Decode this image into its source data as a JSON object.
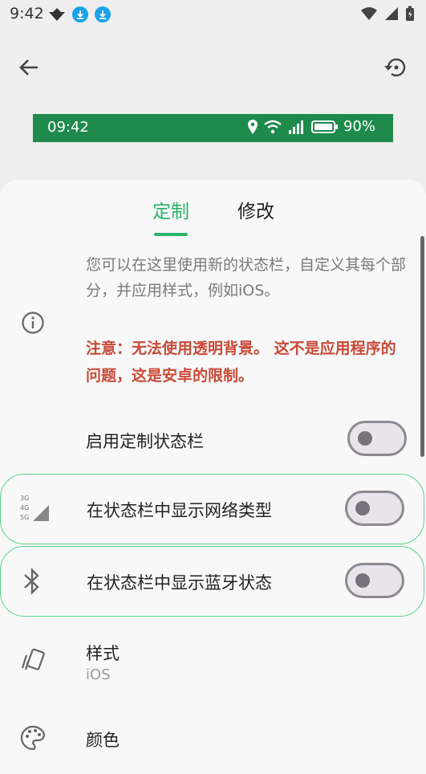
{
  "status_bar": {
    "time": "9:42"
  },
  "preview": {
    "time": "09:42",
    "battery": "90%"
  },
  "tabs": [
    {
      "label": "定制"
    },
    {
      "label": "修改"
    }
  ],
  "info": {
    "text": "您可以在这里使用新的状态栏，自定义其每个部分，并应用样式，例如iOS。",
    "warning": "注意：无法使用透明背景。 这不是应用程序的问题，这是安卓的限制。"
  },
  "settings": [
    {
      "label": "启用定制状态栏",
      "enabled": false
    },
    {
      "label": "在状态栏中显示网络类型",
      "enabled": false
    },
    {
      "label": "在状态栏中显示蓝牙状态",
      "enabled": false
    }
  ],
  "style": {
    "label": "样式",
    "value": "iOS"
  },
  "color": {
    "label": "颜色"
  },
  "network_icon_labels": [
    "3G",
    "4G",
    "5G"
  ],
  "colors": {
    "accent": "#2bb36a",
    "preview_bg": "#1e8a4b",
    "warning": "#c84a38"
  }
}
